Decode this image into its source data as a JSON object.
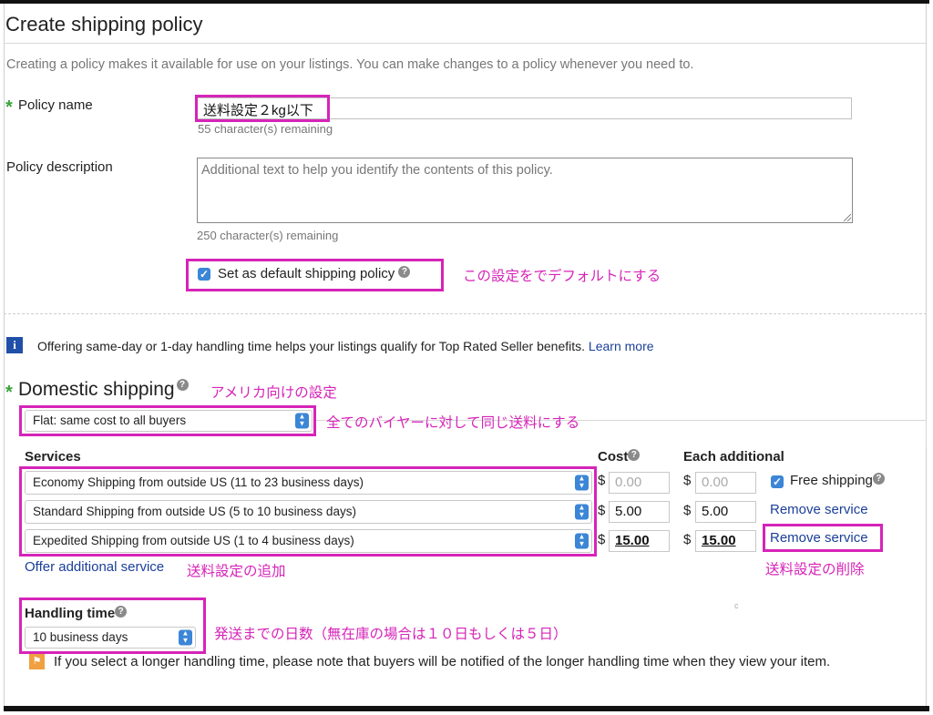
{
  "page": {
    "title": "Create shipping policy",
    "intro": "Creating a policy makes it available for use on your listings. You can make changes to a policy whenever you need to."
  },
  "policy_name": {
    "label": "Policy name",
    "required_mark": "*",
    "value": "送料設定２kg以下",
    "remaining": "55 character(s) remaining"
  },
  "policy_description": {
    "label": "Policy description",
    "placeholder": "Additional text to help you identify the contents of this policy.",
    "remaining": "250 character(s) remaining"
  },
  "default_checkbox": {
    "label": "Set as default shipping policy",
    "checked": true,
    "help_icon": "question-circle-icon"
  },
  "info_banner": {
    "icon": "info-icon",
    "text": "Offering same-day or 1-day handling time helps your listings qualify for Top Rated Seller benefits.",
    "link": "Learn more"
  },
  "domestic": {
    "required_mark": "*",
    "heading": "Domestic shipping",
    "help_icon": "question-circle-icon",
    "type_select": "Flat: same cost to all buyers",
    "services_header": "Services",
    "cost_header": "Cost",
    "additional_header": "Each additional",
    "currency": "$",
    "services": [
      {
        "name": "Economy Shipping from outside US (11 to 23 business days)",
        "cost": "0.00",
        "additional": "0.00",
        "action": "Free shipping"
      },
      {
        "name": "Standard Shipping from outside US (5 to 10 business days)",
        "cost": "5.00",
        "additional": "5.00",
        "action": "Remove service"
      },
      {
        "name": "Expedited Shipping from outside US (1 to 4 business days)",
        "cost": "15.00",
        "additional": "15.00",
        "action": "Remove service"
      }
    ],
    "offer_additional": "Offer additional service"
  },
  "handling": {
    "label": "Handling time",
    "value": "10 business days",
    "warning": "If you select a longer handling time, please note that buyers will be notified of the longer handling time when they view your item."
  },
  "annotations": {
    "default": "この設定をでデフォルトにする",
    "domestic": "アメリカ向けの設定",
    "flat": "全てのバイヤーに対して同じ送料にする",
    "add_service": "送料設定の追加",
    "remove_service": "送料設定の削除",
    "handling": "発送までの日数（無在庫の場合は１０日もしくは５日）"
  },
  "colors": {
    "annotation": "#d624b8",
    "accent": "#3b86d6",
    "link": "#1a3f9a",
    "required": "#3aa33a"
  }
}
